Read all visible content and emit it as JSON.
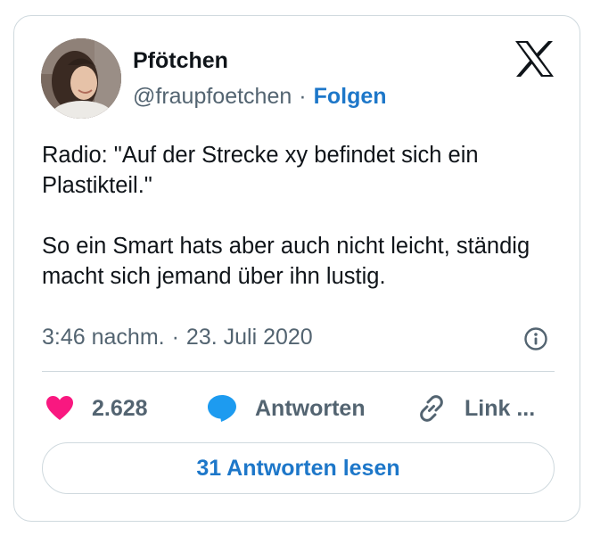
{
  "author": {
    "name": "Pfötchen",
    "handle": "@fraupfoetchen",
    "separator": "·",
    "follow_label": "Folgen"
  },
  "tweet": {
    "paragraphs": [
      "Radio: \"Auf der Strecke xy befindet sich ein Plastikteil.\"",
      "So ein Smart hats aber auch nicht leicht, ständig macht sich jemand über ihn lustig."
    ],
    "time": "3:46 nachm.",
    "separator": "·",
    "date": "23. Juli 2020"
  },
  "actions": {
    "like_count": "2.628",
    "reply_label": "Antworten",
    "link_label": "Link ..."
  },
  "read_replies_label": "31 Antworten lesen",
  "icons": {
    "logo": "x-logo-icon",
    "info": "info-icon",
    "like": "heart-icon",
    "reply": "speech-bubble-icon",
    "link": "link-icon"
  },
  "colors": {
    "accent": "#1d77c9",
    "like": "#f91880",
    "reply": "#1d9bf0",
    "secondary_text": "#536471",
    "border": "#cfd9de"
  }
}
